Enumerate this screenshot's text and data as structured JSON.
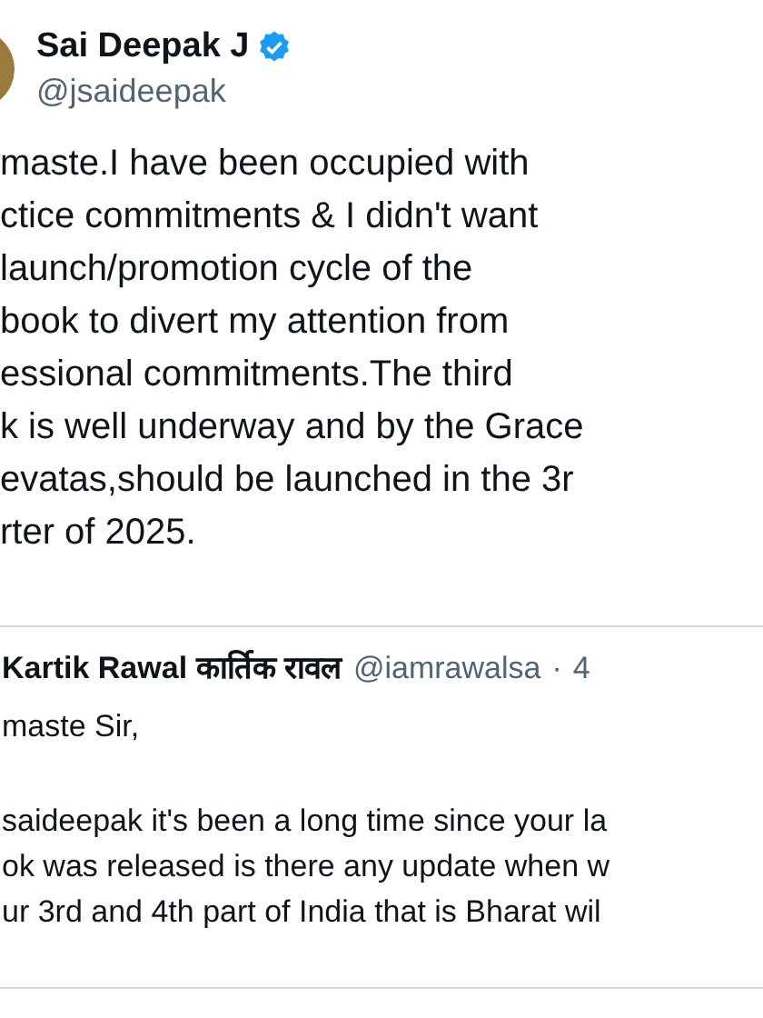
{
  "tweet": {
    "author": {
      "name": "Sai Deepak J",
      "verified": true,
      "handle": "@jsaideepak"
    },
    "lines": [
      "maste.I have been occupied with",
      "ctice commitments & I didn't want",
      "launch/promotion cycle of the",
      "book to divert my attention from",
      "essional commitments.The third",
      "k is well underway and by the Grace",
      "evatas,should be launched in the 3r",
      "rter of 2025."
    ]
  },
  "quoted_tweet": {
    "name": "Kartik Rawal कार्तिक रावल",
    "handle": "@iamrawalsa",
    "separator": "·",
    "time": "4",
    "paragraphs": [
      [
        "maste Sir,"
      ],
      [
        "saideepak it's been a long time since your la",
        "ok was released is there any update when w",
        "ur 3rd and 4th part of India that is Bharat wil"
      ]
    ]
  }
}
